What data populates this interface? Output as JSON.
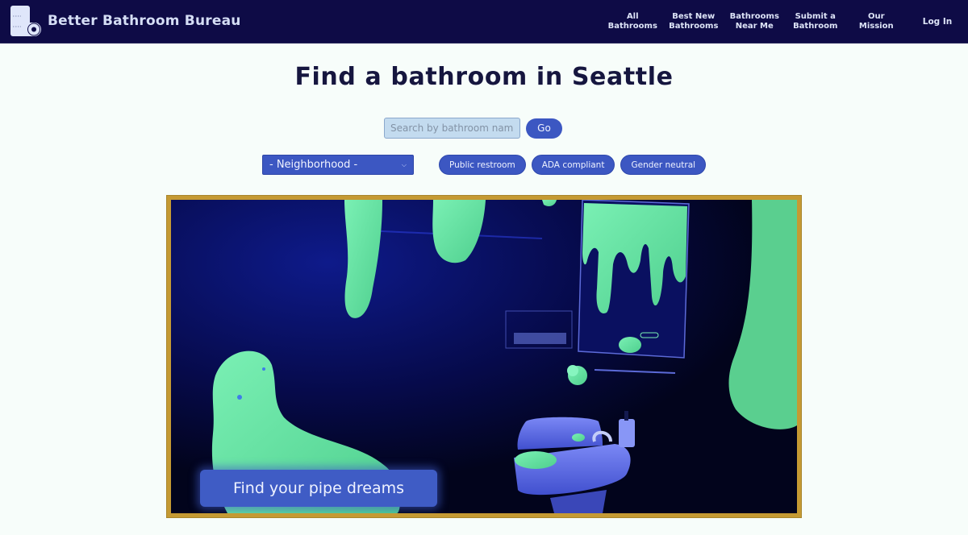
{
  "brand": {
    "name": "Better Bathroom Bureau",
    "logo_icon": "toilet-paper-roll-icon"
  },
  "nav": {
    "items": [
      {
        "label": "All\nBathrooms"
      },
      {
        "label": "Best New\nBathrooms"
      },
      {
        "label": "Bathrooms\nNear Me"
      },
      {
        "label": "Submit a\nBathroom"
      },
      {
        "label": "Our\nMission"
      }
    ],
    "login_label": "Log In"
  },
  "page": {
    "title": "Find a bathroom in Seattle"
  },
  "search": {
    "placeholder": "Search by bathroom name",
    "value": "",
    "go_label": "Go"
  },
  "filters": {
    "neighborhood": {
      "selected": "- Neighborhood -",
      "icon": "chevron-down-icon"
    },
    "chips": [
      {
        "label": "Public restroom"
      },
      {
        "label": "ADA compliant"
      },
      {
        "label": "Gender neutral"
      }
    ]
  },
  "hero": {
    "caption": "Find your pipe dreams",
    "image_description": "Blacklit bathroom with glowing green slime drips on walls, mirror and a blue pedestal sink",
    "colors": {
      "frame": "#c59a33",
      "slime": "#6fe3a6",
      "background": "#04072b",
      "sink": "#5f6fe6"
    }
  },
  "colors": {
    "navbar": "#0e0b46",
    "accent": "#3c57c2",
    "page_bg": "#f7fdfa",
    "title": "#16163f"
  }
}
